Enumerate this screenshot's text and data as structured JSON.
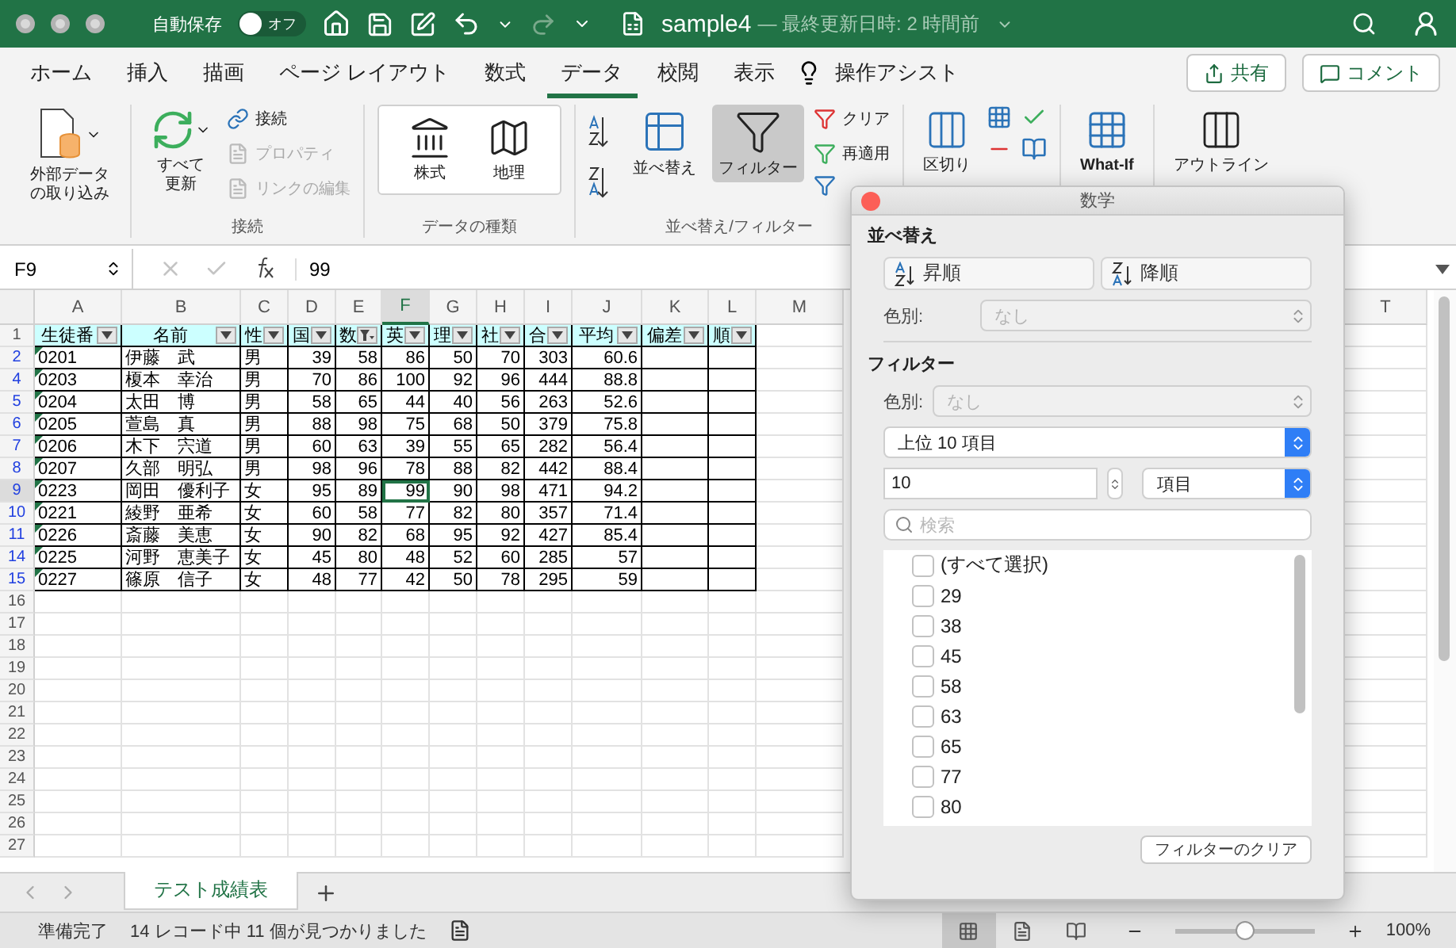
{
  "title_bar": {
    "autosave_label": "自動保存",
    "autosave_toggle": {
      "label": "オフ",
      "on": false
    },
    "document_name": "sample4",
    "document_status": "— 最終更新日時: 2 時間前"
  },
  "ribbon_tabs": [
    {
      "label": "ホーム",
      "selected": false
    },
    {
      "label": "挿入",
      "selected": false
    },
    {
      "label": "描画",
      "selected": false
    },
    {
      "label": "ページ レイアウト",
      "selected": false
    },
    {
      "label": "数式",
      "selected": false
    },
    {
      "label": "データ",
      "selected": true
    },
    {
      "label": "校閲",
      "selected": false
    },
    {
      "label": "表示",
      "selected": false
    }
  ],
  "tell_me": "操作アシスト",
  "share_button": "共有",
  "comment_button": "コメント",
  "ribbon": {
    "get_data": "外部データの取り込み",
    "connections": {
      "label": "接続",
      "refresh_all": "すべて更新",
      "items": [
        {
          "label": "接続",
          "disabled": false
        },
        {
          "label": "プロパティ",
          "disabled": true
        },
        {
          "label": "リンクの編集",
          "disabled": true
        }
      ]
    },
    "data_types": {
      "label": "データの種類",
      "items": [
        "株式",
        "地理"
      ]
    },
    "sort_filter": {
      "label": "並べ替え/フィルター",
      "sort": "並べ替え",
      "filter": {
        "label": "フィルター",
        "selected": true
      },
      "items": [
        "クリア",
        "再適用"
      ]
    },
    "text_to_columns": "区切り",
    "what_if": "What-If",
    "outline": "アウトライン"
  },
  "formula_bar": {
    "name_box": "F9",
    "value": "99"
  },
  "sheet": {
    "filter_applied": true,
    "columns": [
      {
        "letter": "A",
        "selected": false
      },
      {
        "letter": "B",
        "selected": false
      },
      {
        "letter": "C",
        "selected": false
      },
      {
        "letter": "D",
        "selected": false
      },
      {
        "letter": "E",
        "selected": false
      },
      {
        "letter": "F",
        "selected": true
      },
      {
        "letter": "G",
        "selected": false
      },
      {
        "letter": "H",
        "selected": false
      },
      {
        "letter": "I",
        "selected": false
      },
      {
        "letter": "J",
        "selected": false
      },
      {
        "letter": "K",
        "selected": false
      },
      {
        "letter": "L",
        "selected": false
      },
      {
        "letter": "M",
        "selected": false
      },
      {
        "letter": "T",
        "selected": false
      }
    ],
    "header_row": {
      "row_number": "1",
      "cells": [
        {
          "text": "生徒番",
          "filtered": false
        },
        {
          "text": "名前",
          "filtered": false
        },
        {
          "text": "性",
          "filtered": false
        },
        {
          "text": "国",
          "filtered": false
        },
        {
          "text": "数",
          "filtered": true
        },
        {
          "text": "英",
          "filtered": false
        },
        {
          "text": "理",
          "filtered": false
        },
        {
          "text": "社",
          "filtered": false
        },
        {
          "text": "合",
          "filtered": false
        },
        {
          "text": "平均",
          "filtered": false
        },
        {
          "text": "偏差",
          "filtered": false
        },
        {
          "text": "順",
          "filtered": false
        }
      ]
    },
    "rows": [
      {
        "row_number": "2",
        "selected": false,
        "cells": [
          "0201",
          "伊藤　武",
          "男",
          "39",
          "58",
          "86",
          "50",
          "70",
          "303",
          "60.6"
        ]
      },
      {
        "row_number": "4",
        "selected": false,
        "cells": [
          "0203",
          "榎本　幸治",
          "男",
          "70",
          "86",
          "100",
          "92",
          "96",
          "444",
          "88.8"
        ]
      },
      {
        "row_number": "5",
        "selected": false,
        "cells": [
          "0204",
          "太田　博",
          "男",
          "58",
          "65",
          "44",
          "40",
          "56",
          "263",
          "52.6"
        ]
      },
      {
        "row_number": "6",
        "selected": false,
        "cells": [
          "0205",
          "萱島　真",
          "男",
          "88",
          "98",
          "75",
          "68",
          "50",
          "379",
          "75.8"
        ]
      },
      {
        "row_number": "7",
        "selected": false,
        "cells": [
          "0206",
          "木下　宍道",
          "男",
          "60",
          "63",
          "39",
          "55",
          "65",
          "282",
          "56.4"
        ]
      },
      {
        "row_number": "8",
        "selected": false,
        "cells": [
          "0207",
          "久部　明弘",
          "男",
          "98",
          "96",
          "78",
          "88",
          "82",
          "442",
          "88.4"
        ]
      },
      {
        "row_number": "9",
        "selected": true,
        "cells": [
          "0223",
          "岡田　優利子",
          "女",
          "95",
          "89",
          "99",
          "90",
          "98",
          "471",
          "94.2"
        ]
      },
      {
        "row_number": "10",
        "selected": false,
        "cells": [
          "0221",
          "綾野　亜希",
          "女",
          "60",
          "58",
          "77",
          "82",
          "80",
          "357",
          "71.4"
        ]
      },
      {
        "row_number": "11",
        "selected": false,
        "cells": [
          "0226",
          "斎藤　美恵",
          "女",
          "90",
          "82",
          "68",
          "95",
          "92",
          "427",
          "85.4"
        ]
      },
      {
        "row_number": "14",
        "selected": false,
        "cells": [
          "0225",
          "河野　恵美子",
          "女",
          "45",
          "80",
          "48",
          "52",
          "60",
          "285",
          "57"
        ]
      },
      {
        "row_number": "15",
        "selected": false,
        "cells": [
          "0227",
          "篠原　信子",
          "女",
          "48",
          "77",
          "42",
          "50",
          "78",
          "295",
          "59"
        ]
      }
    ],
    "empty_rows": [
      "16",
      "17",
      "18",
      "19",
      "20",
      "21",
      "22",
      "23",
      "24",
      "25",
      "26",
      "27"
    ]
  },
  "sheet_tabs": [
    {
      "label": "テスト成績表",
      "selected": true
    }
  ],
  "filter_panel": {
    "title": "数学",
    "sort_heading": "並べ替え",
    "ascending": "昇順",
    "descending": "降順",
    "sort_color": {
      "label": "色別:",
      "value": "なし",
      "disabled": true
    },
    "filter_heading": "フィルター",
    "filter_color": {
      "label": "色別:",
      "value": "なし",
      "disabled": true
    },
    "rule": "上位 10 項目",
    "count": "10",
    "unit": "項目",
    "search_placeholder": "検索",
    "values": [
      {
        "label": "(すべて選択)",
        "checked": false
      },
      {
        "label": "29",
        "checked": false
      },
      {
        "label": "38",
        "checked": false
      },
      {
        "label": "45",
        "checked": false
      },
      {
        "label": "58",
        "checked": false
      },
      {
        "label": "63",
        "checked": false
      },
      {
        "label": "65",
        "checked": false
      },
      {
        "label": "77",
        "checked": false
      },
      {
        "label": "80",
        "checked": false
      }
    ],
    "clear_button": "フィルターのクリア"
  },
  "status_bar": {
    "ready": "準備完了",
    "records": "14 レコード中 11 個が見つかりました",
    "views": [
      {
        "kind": "normal",
        "selected": true
      },
      {
        "kind": "page_layout",
        "selected": false
      },
      {
        "kind": "page_break",
        "selected": false
      }
    ],
    "zoom": {
      "level": 0.5,
      "label": "100%"
    }
  }
}
